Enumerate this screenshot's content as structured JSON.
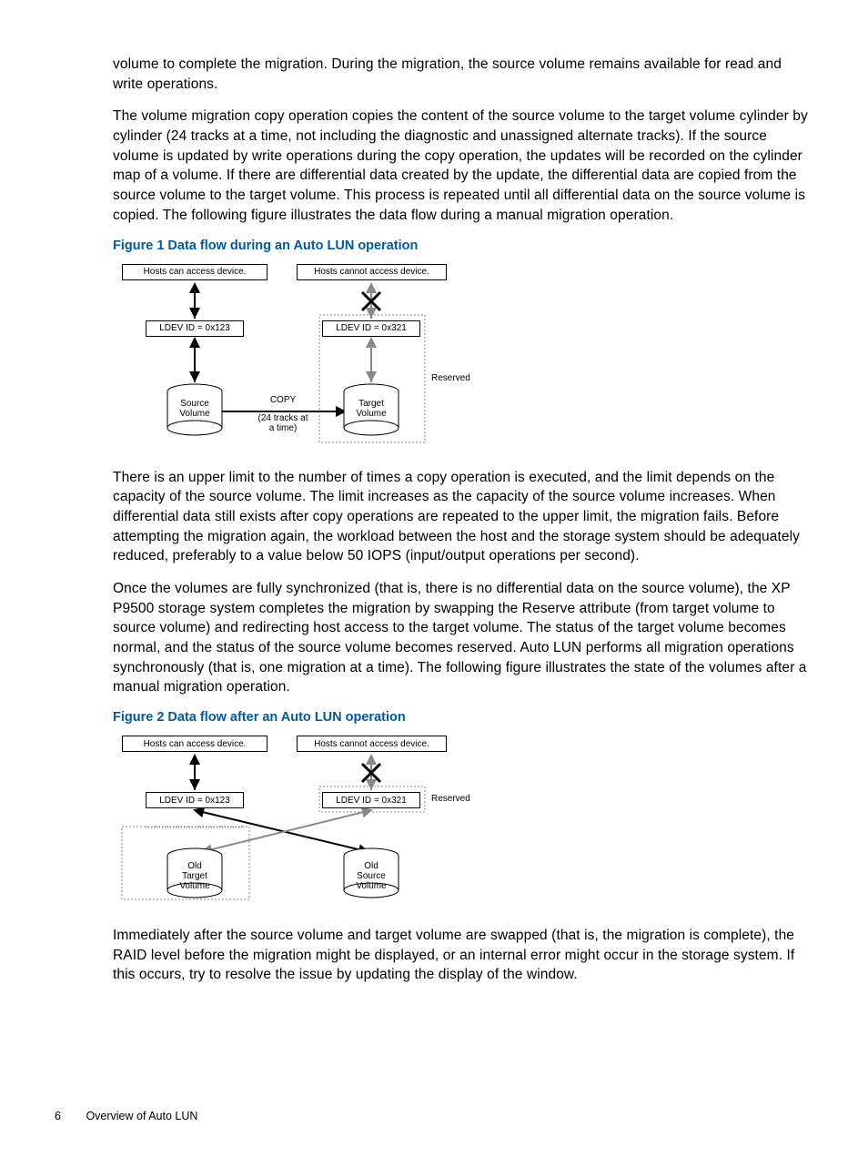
{
  "para1": "volume to complete the migration. During the migration, the source volume remains available for read and write operations.",
  "para2": "The volume migration copy operation copies the content of the source volume to the target volume cylinder by cylinder (24 tracks at a time, not including the diagnostic and unassigned alternate tracks). If the source volume is updated by write operations during the copy operation, the updates will be recorded on the cylinder map of a volume. If there are differential data created by the update, the differential data are copied from the source volume to the target volume. This process is repeated until all differential data on the source volume is copied. The following figure illustrates the data flow during a manual migration operation.",
  "fig1_caption": "Figure 1 Data flow during an Auto LUN operation",
  "fig1": {
    "hosts_can": "Hosts can access device.",
    "hosts_cannot": "Hosts cannot access device.",
    "ldev_src": "LDEV ID = 0x123",
    "ldev_tgt": "LDEV ID = 0x321",
    "src_vol": "Source\nVolume",
    "tgt_vol": "Target\nVolume",
    "copy": "COPY",
    "tracks": "(24 tracks at\na time)",
    "reserved": "Reserved"
  },
  "para3": "There is an upper limit to the number of times a copy operation is executed, and the limit depends on the capacity of the source volume. The limit increases as the capacity of the source volume increases. When differential data still exists after copy operations are repeated to the upper limit, the migration fails. Before attempting the migration again, the workload between the host and the storage system should be adequately reduced, preferably to a value below 50 IOPS (input/output operations per second).",
  "para4": "Once the volumes are fully synchronized (that is, there is no differential data on the source volume), the XP P9500 storage system completes the migration by swapping the Reserve attribute (from target volume to source volume) and redirecting host access to the target volume. The status of the target volume becomes normal, and the status of the source volume becomes reserved. Auto LUN performs all migration operations synchronously (that is, one migration at a time). The following figure illustrates the state of the volumes after a manual migration operation.",
  "fig2_caption": "Figure 2 Data flow after an Auto LUN operation",
  "fig2": {
    "hosts_can": "Hosts can access device.",
    "hosts_cannot": "Hosts cannot access device.",
    "ldev_src": "LDEV ID = 0x123",
    "ldev_tgt": "LDEV ID = 0x321",
    "old_tgt": "Old\nTarget\nVolume",
    "old_src": "Old\nSource\nVolume",
    "reserved": "Reserved"
  },
  "para5": "Immediately after the source volume and target volume are swapped (that is, the migration is complete), the RAID level before the migration might be displayed, or an internal error might occur in the storage system. If this occurs, try to resolve the issue by updating the display of the window.",
  "footer_page": "6",
  "footer_title": "Overview of Auto LUN"
}
